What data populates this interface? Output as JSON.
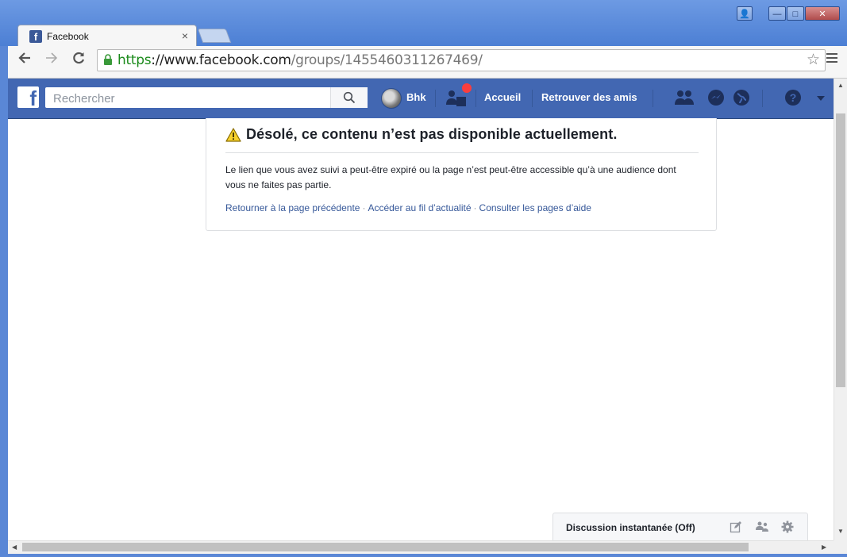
{
  "browser": {
    "tab_title": "Facebook",
    "tab_close": "×",
    "url_scheme": "https",
    "url_host": "://www.facebook.com",
    "url_path": "/groups/1455460311267469/",
    "window_buttons": {
      "user": "👤",
      "minimize": "—",
      "maximize": "□",
      "close": "✕"
    }
  },
  "facebook_bar": {
    "logo": "f",
    "search_placeholder": "Rechercher",
    "profile_name": "Bhk",
    "home_label": "Accueil",
    "find_friends_label": "Retrouver des amis",
    "notification_color": "#fa3e3e"
  },
  "error_card": {
    "heading": "Désolé, ce contenu n’est pas disponible actuellement.",
    "message": "Le lien que vous avez suivi a peut-être expiré ou la page n’est peut-être accessible qu’à une audience dont vous ne faites pas partie.",
    "links": [
      "Retourner à la page précédente",
      "Accéder au fil d’actualité",
      "Consulter les pages d’aide"
    ],
    "separator": "·"
  },
  "chat_bar": {
    "label": "Discussion instantanée (Off)",
    "icons": [
      "compose-icon",
      "group-icon",
      "settings-icon"
    ]
  },
  "colors": {
    "facebook_blue": "#4267b2",
    "link_blue": "#365899",
    "secure_green": "#1a8a1a",
    "window_frame": "#5a87d6"
  }
}
